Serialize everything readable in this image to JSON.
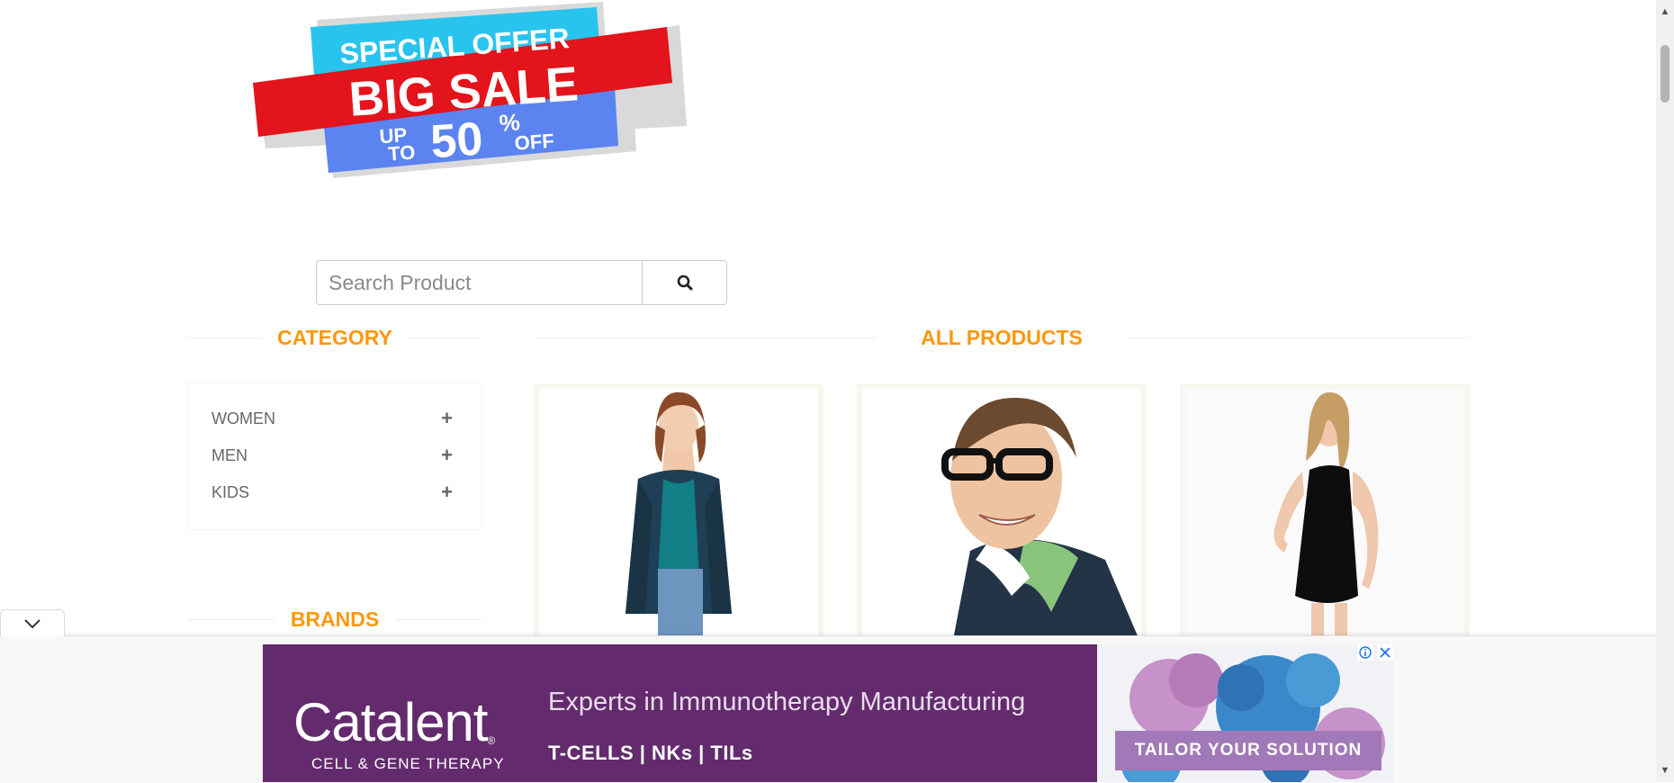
{
  "promo_banner": {
    "line1": "SPECIAL OFFER",
    "line2": "BIG SALE",
    "line3_prefix_top": "UP",
    "line3_prefix_bottom": "TO",
    "line3_number": "50",
    "line3_percent": "%",
    "line3_suffix": "OFF"
  },
  "search": {
    "placeholder": "Search Product",
    "button_icon": "search-icon"
  },
  "category": {
    "title": "CATEGORY",
    "items": [
      {
        "label": "WOMEN",
        "icon": "plus-icon"
      },
      {
        "label": "MEN",
        "icon": "plus-icon"
      },
      {
        "label": "KIDS",
        "icon": "plus-icon"
      }
    ]
  },
  "brands": {
    "title": "BRANDS"
  },
  "products": {
    "title": "ALL PRODUCTS"
  },
  "ad": {
    "brand_name": "Catalent",
    "brand_tm": "®",
    "brand_sub": "CELL & GENE THERAPY",
    "headline": "Experts in Immunotherapy Manufacturing",
    "tags": "T-CELLS | NKs | TILs",
    "cta": "TAILOR YOUR SOLUTION",
    "info_icon": "info-icon",
    "close_icon": "close-icon",
    "collapse_icon": "chevron-down-icon"
  },
  "colors": {
    "accent_orange": "#fe980f",
    "ad_purple": "#632b6e",
    "ad_cta": "#a179b8",
    "promo_red": "#e3141b",
    "promo_cyan": "#29c4ee",
    "promo_blue": "#5b84f0"
  }
}
